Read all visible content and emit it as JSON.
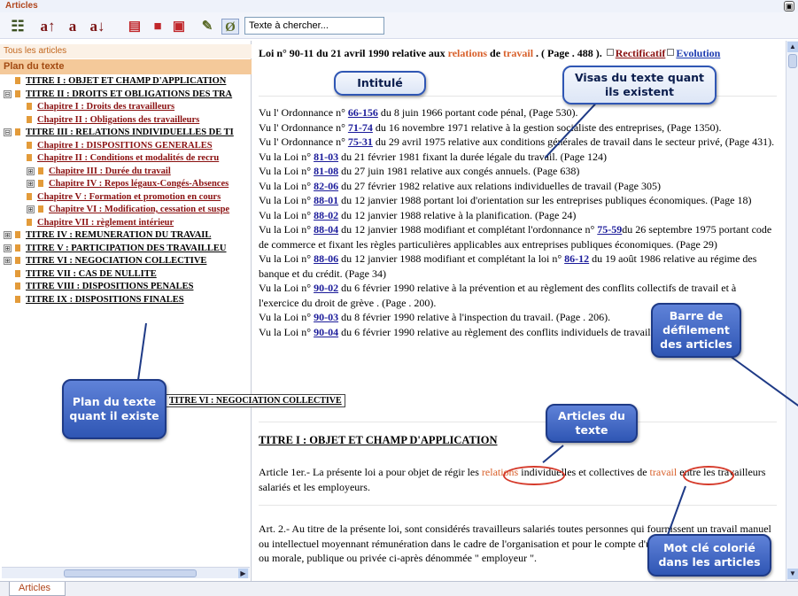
{
  "window": {
    "title": "Articles",
    "collapse_glyph": "▣"
  },
  "toolbar": {
    "buttons": [
      {
        "name": "outline-icon",
        "glyph": "☷"
      },
      {
        "name": "font-increase-button",
        "glyph": "a↑"
      },
      {
        "name": "font-normal-button",
        "glyph": "a"
      },
      {
        "name": "font-decrease-button",
        "glyph": "a↓"
      },
      {
        "name": "print-icon",
        "glyph": "▤"
      },
      {
        "name": "save-icon",
        "glyph": "■"
      },
      {
        "name": "export-icon",
        "glyph": "▣"
      },
      {
        "name": "highlight-icon",
        "glyph": "✎"
      },
      {
        "name": "search-mode-icon",
        "glyph": "Ø"
      }
    ],
    "search_value": "Texte à chercher..."
  },
  "left_panel": {
    "tab_all": "Tous les articles",
    "tab_plan": "Plan du texte",
    "tree": [
      {
        "label": "TITRE I : OBJET ET CHAMP D'APPLICATION",
        "level": 0,
        "expander": ""
      },
      {
        "label": "TITRE II : DROITS ET OBLIGATIONS DES TRA",
        "level": 0,
        "expander": "⊟"
      },
      {
        "label": "Chapitre I : Droits des travailleurs",
        "level": 1,
        "expander": ""
      },
      {
        "label": "Chapitre II : Obligations des travailleurs",
        "level": 1,
        "expander": ""
      },
      {
        "label": "TITRE III : RELATIONS INDIVIDUELLES DE TI",
        "level": 0,
        "expander": "⊟"
      },
      {
        "label": "Chapitre I : DISPOSITIONS GENERALES",
        "level": 1,
        "expander": ""
      },
      {
        "label": "Chapitre II : Conditions et modalités de recru",
        "level": 1,
        "expander": ""
      },
      {
        "label": "Chapitre III : Durée du travail",
        "level": 1,
        "expander": "⊞"
      },
      {
        "label": "Chapitre IV : Repos légaux-Congés-Absences",
        "level": 1,
        "expander": "⊞"
      },
      {
        "label": "Chapitre V : Formation et promotion en cours",
        "level": 1,
        "expander": ""
      },
      {
        "label": "Chapitre VI : Modification, cessation et suspe",
        "level": 1,
        "expander": "⊞"
      },
      {
        "label": "Chapitre VII : règlement intérieur",
        "level": 1,
        "expander": ""
      },
      {
        "label": "TITRE IV : REMUNERATION DU TRAVAIL",
        "level": 0,
        "expander": "⊞"
      },
      {
        "label": "TITRE V : PARTICIPATION DES TRAVAILLEU",
        "level": 0,
        "expander": "⊞"
      },
      {
        "label": "TITRE VI : NEGOCIATION COLLECTIVE",
        "level": 0,
        "expander": "⊞"
      },
      {
        "label": "TITRE VII : CAS DE NULLITE",
        "level": 0,
        "expander": ""
      },
      {
        "label": "TITRE VIII : DISPOSITIONS PENALES",
        "level": 0,
        "expander": ""
      },
      {
        "label": "TITRE IX : DISPOSITIONS FINALES",
        "level": 0,
        "expander": ""
      }
    ],
    "tooltip": "TITRE VI : NEGOCIATION COLLECTIVE"
  },
  "document": {
    "heading": {
      "prefix": "Loi n° 90-11 du 21 avril 1990 relative aux ",
      "kw1": "relations",
      "mid": " de ",
      "kw2": "travail",
      "suffix": " . ( Page . 488 ). ",
      "rectificatif": "Rectificatif",
      "evolution": "Evolution"
    },
    "visas": [
      {
        "pre": "Vu l'  Ordonnance n° ",
        "ref": "66-156",
        "post": " du 8 juin 1966 portant code pénal, (Page 530)."
      },
      {
        "pre": "Vu l'  Ordonnance n° ",
        "ref": "71-74",
        "post": " du 16 novembre 1971 relative à la gestion socialiste des entreprises, (Page 1350)."
      },
      {
        "pre": "Vu l'  Ordonnance n° ",
        "ref": "75-31",
        "post": " du 29 avril 1975 relative aux conditions générales de travail dans le secteur privé, (Page 431)."
      },
      {
        "pre": "Vu la Loi n° ",
        "ref": "81-03",
        "post": " du 21 février 1981 fixant la durée légale du travail. (Page 124)"
      },
      {
        "pre": "Vu la Loi n° ",
        "ref": "81-08",
        "post": " du 27 juin 1981 relative aux congés annuels. (Page 638)"
      },
      {
        "pre": "Vu la Loi n° ",
        "ref": "82-06",
        "post": " du 27 février 1982 relative aux relations individuelles de travail (Page 305)"
      },
      {
        "pre": "Vu la Loi n° ",
        "ref": "88-01",
        "post": " du 12 janvier 1988 portant loi d'orientation sur les entreprises publiques économiques. (Page 18)"
      },
      {
        "pre": "Vu la Loi n° ",
        "ref": "88-02",
        "post": " du 12 janvier 1988 relative à la planification. (Page 24)"
      },
      {
        "pre": "Vu la Loi n° ",
        "ref": "88-04",
        "post": " du 12 janvier 1988 modifiant et complétant l'ordonnance n°  ",
        "ref2": "75-59",
        "post2": "du 26 septembre 1975 portant code de commerce et fixant les règles particulières applicables aux entreprises publiques économiques. (Page 29)"
      },
      {
        "pre": "Vu la Loi n° ",
        "ref": "88-06",
        "post": " du 12 janvier 1988 modifiant et complétant la loi n° ",
        "ref2": "86-12",
        "post2": " du 19 août 1986 relative au régime des banque et du crédit. (Page 34)"
      },
      {
        "pre": "Vu la Loi n° ",
        "ref": "90-02",
        "post": " du 6 février 1990 relative à la prévention et au  règlement des conflits collectifs de travail et à l'exercice du droit de grève . (Page . 200)."
      },
      {
        "pre": "Vu la Loi n° ",
        "ref": "90-03",
        "post": " du 8 février 1990 relative à l'inspection du travail. (Page .  206)."
      },
      {
        "pre": "Vu la Loi n° ",
        "ref": "90-04",
        "post": " du 6 février 1990 relative au règlement des conflits individuels de travail. (Page. 208)."
      }
    ],
    "titre": "TITRE I : OBJET ET CHAMP D'APPLICATION",
    "article1": {
      "a": "Article 1er.- La présente loi a pour objet de régir les ",
      "kw1": "relations",
      "b": " individuelles et collectives de ",
      "kw2": "travail",
      "c": " entre les travailleurs salariés et les employeurs."
    },
    "article2": "Art. 2.- Au titre de la présente loi, sont considérés travailleurs salariés toutes personnes qui fournissent un travail manuel ou intellectuel moyennant rémunération dans le cadre de l'organisation et pour le compte d'une autre personne physique ou morale, publique ou privée ci-après dénommée \" employeur \"."
  },
  "callouts": {
    "intitule": "Intitulé",
    "visas": "Visas du texte quant ils existent",
    "barre": "Barre de défilement des articles",
    "plan": "Plan du texte quant il existe",
    "articles": "Articles du texte",
    "motcle": "Mot clé colorié dans les articles"
  },
  "bottom": {
    "tab": "Articles"
  },
  "colors": {
    "accent": "#d8602b",
    "callout": "#2f56b4",
    "ring": "#d53a2a"
  }
}
